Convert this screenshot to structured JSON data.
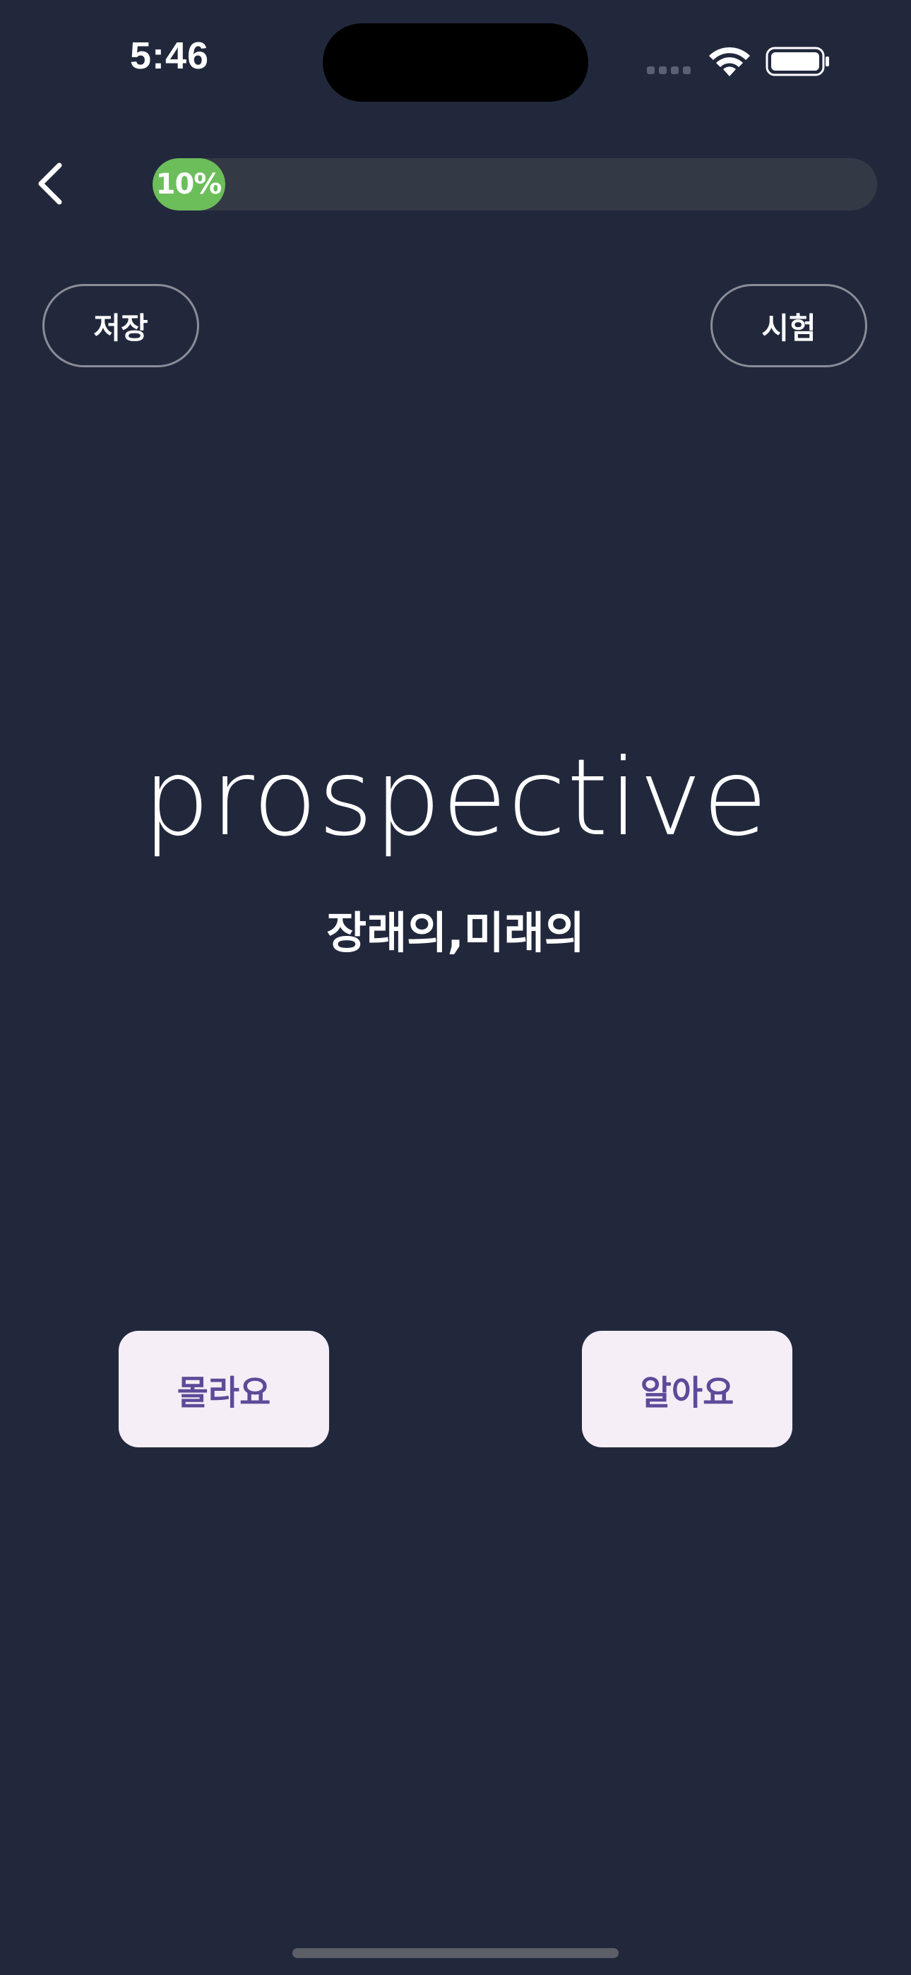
{
  "status_bar": {
    "time": "5:46"
  },
  "nav": {
    "back_icon": "chevron-left-icon",
    "progress_percent": 10,
    "progress_label": "10%",
    "progress_color": "#6bbe5a"
  },
  "actions": {
    "save_label": "저장",
    "test_label": "시험"
  },
  "card": {
    "word": "prospective",
    "meaning": "장래의,미래의"
  },
  "answers": {
    "dont_know_label": "몰라요",
    "know_label": "알아요"
  },
  "colors": {
    "background": "#22283c",
    "answer_button_bg": "#f5eef7",
    "answer_button_text": "#5e4a98"
  }
}
